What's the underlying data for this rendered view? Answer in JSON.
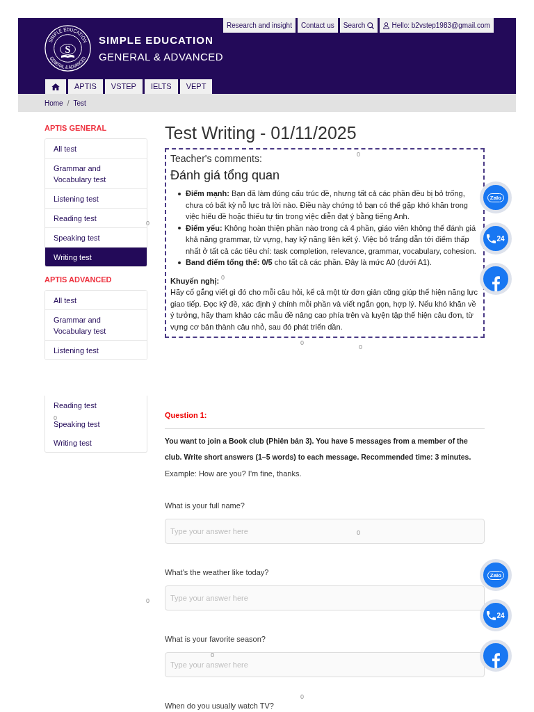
{
  "header": {
    "logo": {
      "letter": "S",
      "ring_top": "SIMPLE EDUCATION",
      "ring_bottom": "GENERAL & ADVANCED"
    },
    "brand_title": "SIMPLE EDUCATION",
    "brand_subtitle": "GENERAL & ADVANCED",
    "top_links": [
      {
        "kind": "link",
        "label": "Research and insight"
      },
      {
        "kind": "link",
        "label": "Contact us"
      },
      {
        "kind": "search",
        "label": "Search"
      },
      {
        "kind": "account",
        "label": "Hello: b2vstep1983@gmail.com"
      }
    ],
    "main_nav": [
      {
        "kind": "home"
      },
      {
        "kind": "text",
        "label": "APTIS"
      },
      {
        "kind": "text",
        "label": "VSTEP"
      },
      {
        "kind": "text",
        "label": "IELTS"
      },
      {
        "kind": "text",
        "label": "VEPT"
      }
    ]
  },
  "breadcrumb": {
    "items": [
      "Home",
      "Test"
    ],
    "separator": "/"
  },
  "sidebar": {
    "sections": [
      {
        "heading": "APTIS GENERAL",
        "items": [
          {
            "label": "All test",
            "selected": false
          },
          {
            "label": "Grammar and Vocabulary test",
            "selected": false
          },
          {
            "label": "Listening test",
            "selected": false
          },
          {
            "label": "Reading test",
            "selected": false
          },
          {
            "label": "Speaking test",
            "selected": false
          },
          {
            "label": "Writing test",
            "selected": true
          }
        ]
      },
      {
        "heading": "APTIS ADVANCED",
        "items": [
          {
            "label": "All test",
            "selected": false
          },
          {
            "label": "Grammar and Vocabulary test",
            "selected": false
          },
          {
            "label": "Listening test",
            "selected": false
          }
        ],
        "detached_items": [
          {
            "label": "Reading test",
            "selected": false
          },
          {
            "label": "Speaking test",
            "selected": false
          },
          {
            "label": "Writing test",
            "selected": false
          }
        ]
      }
    ]
  },
  "page_title": "Test Writing - 01/11/2025",
  "teacher_comments": {
    "label": "Teacher's comments:",
    "heading": "Đánh giá tổng quan",
    "points": [
      "**Điểm mạnh:** Bạn đã làm đúng cấu trúc đề, nhưng tất cả các phần đều bị bỏ trống, chưa có bất kỳ nỗ lực trả lời nào. Điều này chứng tỏ bạn có thể gặp khó khăn trong việc hiểu đề hoặc thiếu tự tin trong việc diễn đạt ý bằng tiếng Anh.",
      "**Điểm yếu:** Không hoàn thiện phần nào trong cả 4 phần, giáo viên không thể đánh giá khả năng grammar, từ vựng, hay kỹ năng liên kết ý. Việc bỏ trắng dẫn tới điểm thấp nhất ở tất cả các tiêu chí: task completion, relevance, grammar, vocabulary, cohesion.",
      "**Band điểm tổng thể:** **0/5** cho tất cả các phần. Đây là mức A0 (dưới A1)."
    ],
    "recommendation_label": "Khuyến nghị:",
    "recommendation": "Hãy cố gắng viết gì đó cho mỗi câu hỏi, kể cả một từ đơn giản cũng giúp thể hiện năng lực giao tiếp. Đọc kỹ đề, xác định ý chính mỗi phần và viết ngắn gọn, hợp lý. Nếu khó khăn về ý tưởng, hãy tham khảo các mẫu đề nâng cao phía trên và luyện tập thể hiện câu đơn, từ vựng cơ bản thành câu nhỏ, sau đó phát triển dần."
  },
  "question": {
    "heading": "Question 1:",
    "instructions": "You want to join a Book club (Phiên bản 3). You have 5 messages from a member of the club. Write short answers (1–5 words) to each message. Recommended time: 3 minutes.",
    "example": "Example: How are you? I'm fine, thanks.",
    "items": [
      {
        "prompt": "What is your full name?",
        "placeholder": "Type your answer here"
      },
      {
        "prompt": "What's the weather like today?",
        "placeholder": "Type your answer here"
      },
      {
        "prompt": "What is your favorite season?",
        "placeholder": "Type your answer here"
      },
      {
        "prompt": "When do you usually watch TV?"
      }
    ]
  },
  "floating_buttons": [
    {
      "kind": "zalo",
      "label": "Zalo"
    },
    {
      "kind": "hotline",
      "label": "24"
    },
    {
      "kind": "facebook"
    },
    {
      "kind": "zalo",
      "label": "Zalo"
    },
    {
      "kind": "hotline",
      "label": "24"
    },
    {
      "kind": "facebook"
    }
  ],
  "counter_marks": [
    "0",
    "0",
    "0",
    "0",
    "0",
    "0",
    "0",
    "0",
    "0",
    "0"
  ]
}
